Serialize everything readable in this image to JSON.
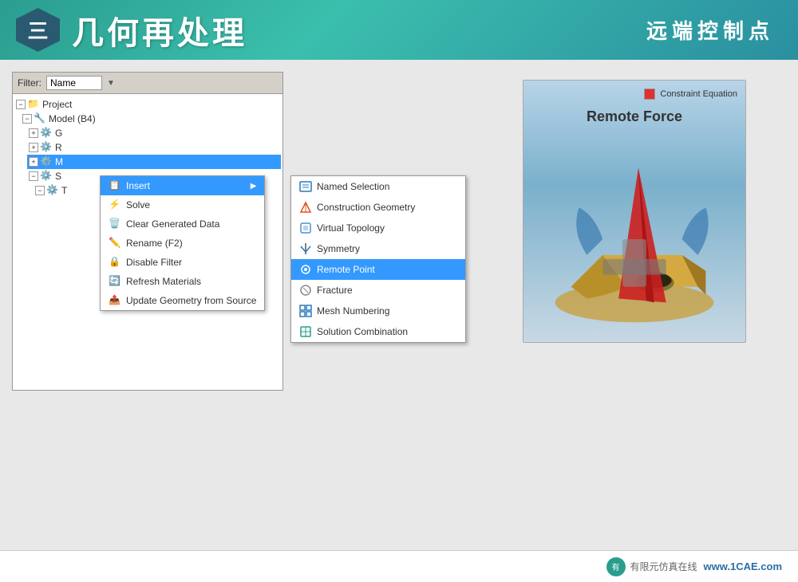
{
  "header": {
    "hexagon_label": "三",
    "title": "几何再处理",
    "subtitle": "远端控制点"
  },
  "filter": {
    "label": "Filter:",
    "value": "Name"
  },
  "tree": {
    "project_label": "Project",
    "model_label": "Model (B4)",
    "items": [
      {
        "label": "G",
        "indent": 2
      },
      {
        "label": "R",
        "indent": 2
      },
      {
        "label": "M",
        "indent": 2
      },
      {
        "label": "S",
        "indent": 2
      }
    ]
  },
  "context_menu": {
    "items": [
      {
        "label": "Insert",
        "has_arrow": true,
        "highlighted": true
      },
      {
        "label": "Solve"
      },
      {
        "label": "Clear Generated Data"
      },
      {
        "label": "Rename (F2)"
      },
      {
        "label": "Disable Filter"
      },
      {
        "label": "Refresh Materials"
      },
      {
        "label": "Update Geometry from Source"
      }
    ]
  },
  "submenu": {
    "items": [
      {
        "label": "Named Selection"
      },
      {
        "label": "Construction Geometry"
      },
      {
        "label": "Virtual Topology"
      },
      {
        "label": "Symmetry"
      },
      {
        "label": "Remote Point",
        "highlighted": true
      },
      {
        "label": "Fracture"
      },
      {
        "label": "Mesh Numbering"
      },
      {
        "label": "Solution Combination"
      }
    ]
  },
  "model_view": {
    "legend_label": "Constraint Equation",
    "title": "Remote Force"
  },
  "footer": {
    "logo_text": "有限元仿真在线",
    "site": "www.1CAE.com"
  }
}
